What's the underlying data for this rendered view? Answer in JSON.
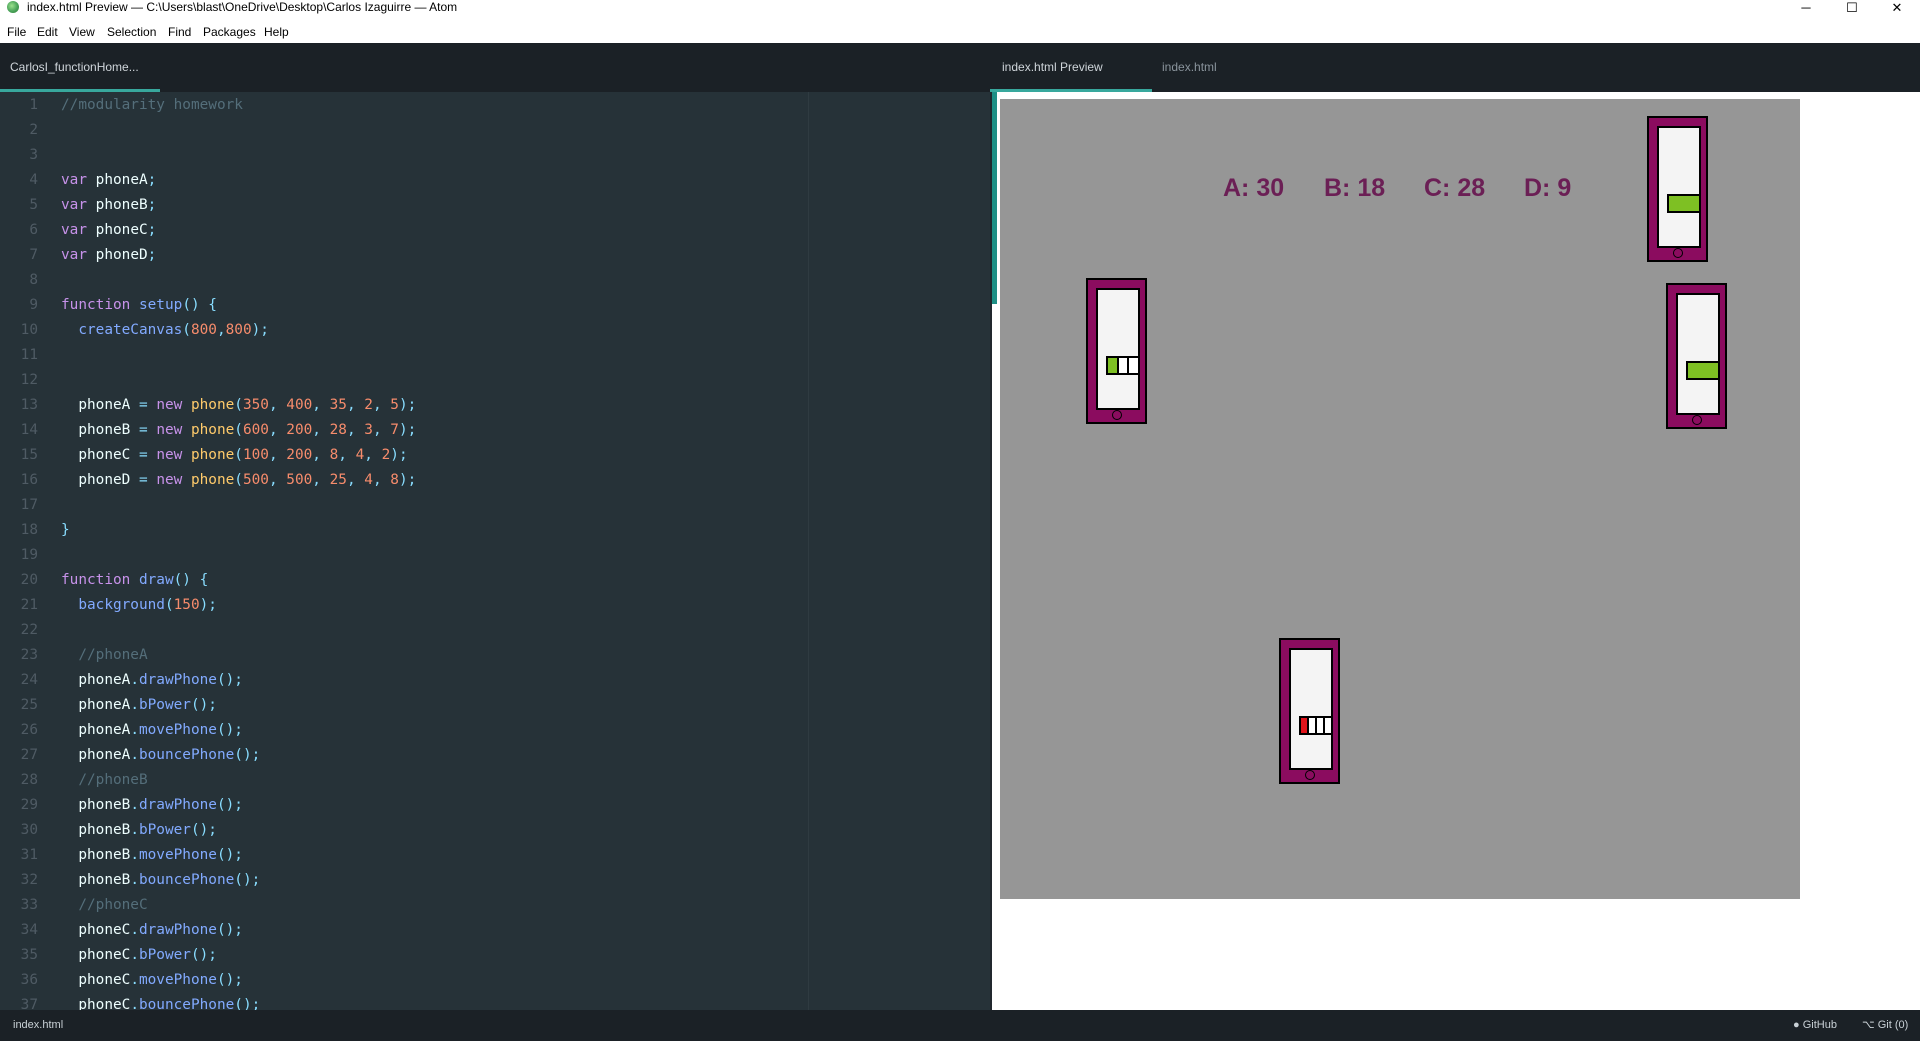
{
  "window": {
    "title": "index.html Preview — C:\\Users\\blast\\OneDrive\\Desktop\\Carlos Izaguirre — Atom",
    "minimize": "─",
    "maximize": "☐",
    "close": "✕"
  },
  "menu": [
    "File",
    "Edit",
    "View",
    "Selection",
    "Find",
    "Packages",
    "Help"
  ],
  "left_tabs": [
    {
      "label": "CarlosI_functionHome..."
    }
  ],
  "right_tabs": [
    {
      "label": "index.html Preview"
    },
    {
      "label": "index.html"
    }
  ],
  "editor": {
    "lines": [
      {
        "n": "1",
        "tokens": [
          [
            "comment",
            "//modularity homework"
          ]
        ]
      },
      {
        "n": "2",
        "tokens": []
      },
      {
        "n": "3",
        "tokens": []
      },
      {
        "n": "4",
        "tokens": [
          [
            "kw",
            "var"
          ],
          [
            "var",
            " phoneA"
          ],
          [
            "punc",
            ";"
          ]
        ]
      },
      {
        "n": "5",
        "tokens": [
          [
            "kw",
            "var"
          ],
          [
            "var",
            " phoneB"
          ],
          [
            "punc",
            ";"
          ]
        ]
      },
      {
        "n": "6",
        "tokens": [
          [
            "kw",
            "var"
          ],
          [
            "var",
            " phoneC"
          ],
          [
            "punc",
            ";"
          ]
        ]
      },
      {
        "n": "7",
        "tokens": [
          [
            "kw",
            "var"
          ],
          [
            "var",
            " phoneD"
          ],
          [
            "punc",
            ";"
          ]
        ]
      },
      {
        "n": "8",
        "tokens": []
      },
      {
        "n": "9",
        "tokens": [
          [
            "kw",
            "function"
          ],
          [
            "var",
            " "
          ],
          [
            "fn",
            "setup"
          ],
          [
            "punc",
            "() {"
          ]
        ]
      },
      {
        "n": "10",
        "tokens": [
          [
            "var",
            "  "
          ],
          [
            "fn",
            "createCanvas"
          ],
          [
            "punc",
            "("
          ],
          [
            "num",
            "800"
          ],
          [
            "punc",
            ","
          ],
          [
            "num",
            "800"
          ],
          [
            "punc",
            ");"
          ]
        ]
      },
      {
        "n": "11",
        "tokens": []
      },
      {
        "n": "12",
        "tokens": []
      },
      {
        "n": "13",
        "tokens": [
          [
            "var",
            "  phoneA "
          ],
          [
            "punc",
            "= "
          ],
          [
            "kw",
            "new "
          ],
          [
            "cls",
            "phone"
          ],
          [
            "punc",
            "("
          ],
          [
            "num",
            "350"
          ],
          [
            "punc",
            ", "
          ],
          [
            "num",
            "400"
          ],
          [
            "punc",
            ", "
          ],
          [
            "num",
            "35"
          ],
          [
            "punc",
            ", "
          ],
          [
            "num",
            "2"
          ],
          [
            "punc",
            ", "
          ],
          [
            "num",
            "5"
          ],
          [
            "punc",
            ");"
          ]
        ]
      },
      {
        "n": "14",
        "tokens": [
          [
            "var",
            "  phoneB "
          ],
          [
            "punc",
            "= "
          ],
          [
            "kw",
            "new "
          ],
          [
            "cls",
            "phone"
          ],
          [
            "punc",
            "("
          ],
          [
            "num",
            "600"
          ],
          [
            "punc",
            ", "
          ],
          [
            "num",
            "200"
          ],
          [
            "punc",
            ", "
          ],
          [
            "num",
            "28"
          ],
          [
            "punc",
            ", "
          ],
          [
            "num",
            "3"
          ],
          [
            "punc",
            ", "
          ],
          [
            "num",
            "7"
          ],
          [
            "punc",
            ");"
          ]
        ]
      },
      {
        "n": "15",
        "tokens": [
          [
            "var",
            "  phoneC "
          ],
          [
            "punc",
            "= "
          ],
          [
            "kw",
            "new "
          ],
          [
            "cls",
            "phone"
          ],
          [
            "punc",
            "("
          ],
          [
            "num",
            "100"
          ],
          [
            "punc",
            ", "
          ],
          [
            "num",
            "200"
          ],
          [
            "punc",
            ", "
          ],
          [
            "num",
            "8"
          ],
          [
            "punc",
            ", "
          ],
          [
            "num",
            "4"
          ],
          [
            "punc",
            ", "
          ],
          [
            "num",
            "2"
          ],
          [
            "punc",
            ");"
          ]
        ]
      },
      {
        "n": "16",
        "tokens": [
          [
            "var",
            "  phoneD "
          ],
          [
            "punc",
            "= "
          ],
          [
            "kw",
            "new "
          ],
          [
            "cls",
            "phone"
          ],
          [
            "punc",
            "("
          ],
          [
            "num",
            "500"
          ],
          [
            "punc",
            ", "
          ],
          [
            "num",
            "500"
          ],
          [
            "punc",
            ", "
          ],
          [
            "num",
            "25"
          ],
          [
            "punc",
            ", "
          ],
          [
            "num",
            "4"
          ],
          [
            "punc",
            ", "
          ],
          [
            "num",
            "8"
          ],
          [
            "punc",
            ");"
          ]
        ]
      },
      {
        "n": "17",
        "tokens": []
      },
      {
        "n": "18",
        "tokens": [
          [
            "punc",
            "}"
          ]
        ]
      },
      {
        "n": "19",
        "tokens": []
      },
      {
        "n": "20",
        "tokens": [
          [
            "kw",
            "function"
          ],
          [
            "var",
            " "
          ],
          [
            "fn",
            "draw"
          ],
          [
            "punc",
            "() {"
          ]
        ]
      },
      {
        "n": "21",
        "tokens": [
          [
            "var",
            "  "
          ],
          [
            "fn",
            "background"
          ],
          [
            "punc",
            "("
          ],
          [
            "num",
            "150"
          ],
          [
            "punc",
            ");"
          ]
        ]
      },
      {
        "n": "22",
        "tokens": []
      },
      {
        "n": "23",
        "tokens": [
          [
            "comment",
            "  //phoneA"
          ]
        ]
      },
      {
        "n": "24",
        "tokens": [
          [
            "var",
            "  phoneA"
          ],
          [
            "punc",
            "."
          ],
          [
            "fn",
            "drawPhone"
          ],
          [
            "punc",
            "();"
          ]
        ]
      },
      {
        "n": "25",
        "tokens": [
          [
            "var",
            "  phoneA"
          ],
          [
            "punc",
            "."
          ],
          [
            "fn",
            "bPower"
          ],
          [
            "punc",
            "();"
          ]
        ]
      },
      {
        "n": "26",
        "tokens": [
          [
            "var",
            "  phoneA"
          ],
          [
            "punc",
            "."
          ],
          [
            "fn",
            "movePhone"
          ],
          [
            "punc",
            "();"
          ]
        ]
      },
      {
        "n": "27",
        "tokens": [
          [
            "var",
            "  phoneA"
          ],
          [
            "punc",
            "."
          ],
          [
            "fn",
            "bouncePhone"
          ],
          [
            "punc",
            "();"
          ]
        ]
      },
      {
        "n": "28",
        "tokens": [
          [
            "comment",
            "  //phoneB"
          ]
        ]
      },
      {
        "n": "29",
        "tokens": [
          [
            "var",
            "  phoneB"
          ],
          [
            "punc",
            "."
          ],
          [
            "fn",
            "drawPhone"
          ],
          [
            "punc",
            "();"
          ]
        ]
      },
      {
        "n": "30",
        "tokens": [
          [
            "var",
            "  phoneB"
          ],
          [
            "punc",
            "."
          ],
          [
            "fn",
            "bPower"
          ],
          [
            "punc",
            "();"
          ]
        ]
      },
      {
        "n": "31",
        "tokens": [
          [
            "var",
            "  phoneB"
          ],
          [
            "punc",
            "."
          ],
          [
            "fn",
            "movePhone"
          ],
          [
            "punc",
            "();"
          ]
        ]
      },
      {
        "n": "32",
        "tokens": [
          [
            "var",
            "  phoneB"
          ],
          [
            "punc",
            "."
          ],
          [
            "fn",
            "bouncePhone"
          ],
          [
            "punc",
            "();"
          ]
        ]
      },
      {
        "n": "33",
        "tokens": [
          [
            "comment",
            "  //phoneC"
          ]
        ]
      },
      {
        "n": "34",
        "tokens": [
          [
            "var",
            "  phoneC"
          ],
          [
            "punc",
            "."
          ],
          [
            "fn",
            "drawPhone"
          ],
          [
            "punc",
            "();"
          ]
        ]
      },
      {
        "n": "35",
        "tokens": [
          [
            "var",
            "  phoneC"
          ],
          [
            "punc",
            "."
          ],
          [
            "fn",
            "bPower"
          ],
          [
            "punc",
            "();"
          ]
        ]
      },
      {
        "n": "36",
        "tokens": [
          [
            "var",
            "  phoneC"
          ],
          [
            "punc",
            "."
          ],
          [
            "fn",
            "movePhone"
          ],
          [
            "punc",
            "();"
          ]
        ]
      },
      {
        "n": "37",
        "tokens": [
          [
            "var",
            "  phoneC"
          ],
          [
            "punc",
            "."
          ],
          [
            "fn",
            "bouncePhone"
          ],
          [
            "punc",
            "();"
          ]
        ]
      }
    ]
  },
  "preview": {
    "scores": [
      {
        "label": "A: 30"
      },
      {
        "label": "B: 18"
      },
      {
        "label": "C: 28"
      },
      {
        "label": "D: 9"
      }
    ],
    "phones": [
      {
        "id": "phone-1",
        "cells": [
          {
            "color": "#7ec023"
          }
        ]
      },
      {
        "id": "phone-2",
        "cells": [
          {
            "color": "#7ec023"
          },
          {
            "color": "#ffffff"
          },
          {
            "color": "#ffffff"
          }
        ]
      },
      {
        "id": "phone-3",
        "cells": [
          {
            "color": "#7ec023"
          }
        ]
      },
      {
        "id": "phone-4",
        "cells": [
          {
            "color": "#e0141b"
          },
          {
            "color": "#ffffff"
          },
          {
            "color": "#ffffff"
          },
          {
            "color": "#ffffff"
          }
        ]
      }
    ]
  },
  "status": {
    "file": "index.html",
    "github": "GitHub",
    "git": "Git (0)"
  },
  "colors": {
    "accent": "#38a89d",
    "phone_body": "#8b0c5f",
    "canvas_bg": "#969696"
  }
}
